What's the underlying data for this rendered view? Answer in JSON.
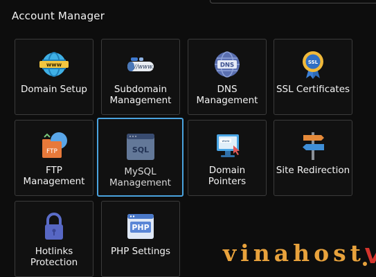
{
  "header": {
    "title": "Account Manager"
  },
  "tiles": [
    {
      "label": "Domain Setup",
      "icon": "globe-www-icon"
    },
    {
      "label": "Subdomain Management",
      "icon": "www-pill-icon"
    },
    {
      "label": "DNS Management",
      "icon": "dns-globe-icon"
    },
    {
      "label": "SSL Certificates",
      "icon": "ssl-badge-icon"
    },
    {
      "label": "FTP Management",
      "icon": "ftp-folder-icon"
    },
    {
      "label": "MySQL Management",
      "icon": "sql-window-icon",
      "selected": true
    },
    {
      "label": "Domain Pointers",
      "icon": "monitor-www-icon"
    },
    {
      "label": "Site Redirection",
      "icon": "signpost-icon"
    },
    {
      "label": "Hotlinks Protection",
      "icon": "padlock-icon"
    },
    {
      "label": "PHP Settings",
      "icon": "php-window-icon"
    }
  ],
  "watermark": {
    "text": "vinahost",
    "mark": "V"
  },
  "colors": {
    "accent_selected": "#4aa3df",
    "brand": "#e8a23c"
  }
}
